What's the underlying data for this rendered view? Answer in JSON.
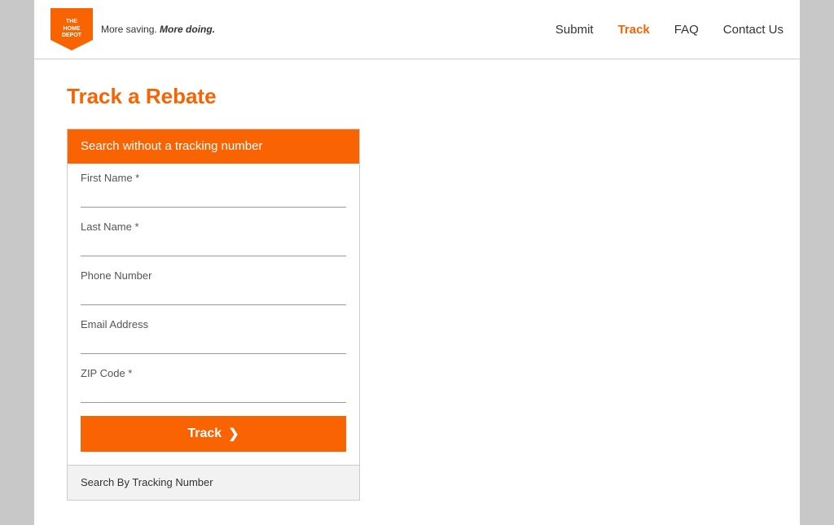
{
  "header": {
    "logo": {
      "line1": "THE",
      "line2": "HOME",
      "line3": "DEPOT",
      "tagline_plain": "More saving.",
      "tagline_bold": "More doing."
    },
    "nav": {
      "submit": "Submit",
      "track": "Track",
      "faq": "FAQ",
      "contact": "Contact Us"
    }
  },
  "page": {
    "title": "Track a Rebate"
  },
  "form": {
    "section_title": "Search without a tracking number",
    "first_name_label": "First Name *",
    "first_name_placeholder": "",
    "last_name_label": "Last Name *",
    "last_name_placeholder": "",
    "phone_label": "Phone Number",
    "phone_placeholder": "",
    "email_label": "Email Address",
    "email_placeholder": "",
    "zip_label": "ZIP Code *",
    "zip_placeholder": "",
    "track_button": "Track",
    "track_chevron": "❯",
    "footer_text": "Search By Tracking Number"
  }
}
